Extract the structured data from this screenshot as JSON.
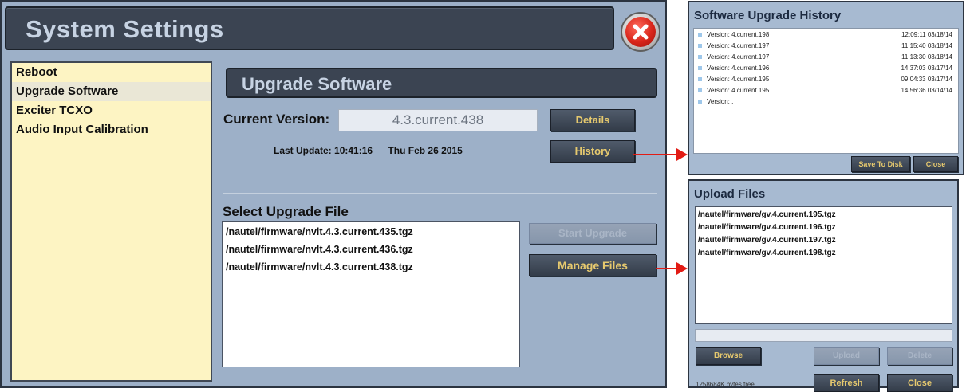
{
  "main": {
    "title": "System Settings",
    "sidebar": {
      "items": [
        {
          "label": "Reboot"
        },
        {
          "label": "Upgrade Software"
        },
        {
          "label": "Exciter TCXO"
        },
        {
          "label": "Audio Input Calibration"
        }
      ],
      "selected": "Upgrade Software"
    },
    "section_title": "Upgrade Software",
    "current_version_label": "Current Version:",
    "current_version_value": "4.3.current.438",
    "details_label": "Details",
    "history_label": "History",
    "last_update_label": "Last Update:",
    "last_update_time": "10:41:16",
    "last_update_date": "Thu Feb 26 2015",
    "select_file_label": "Select Upgrade File",
    "files": [
      "/nautel/firmware/nvlt.4.3.current.435.tgz",
      "/nautel/firmware/nvlt.4.3.current.436.tgz",
      "/nautel/firmware/nvlt.4.3.current.438.tgz"
    ],
    "start_upgrade_label": "Start Upgrade",
    "manage_files_label": "Manage Files"
  },
  "history_panel": {
    "title": "Software Upgrade History",
    "entries": [
      {
        "version": "Version: 4.current.198",
        "timestamp": "12:09:11 03/18/14"
      },
      {
        "version": "Version: 4.current.197",
        "timestamp": "11:15:40 03/18/14"
      },
      {
        "version": "Version: 4.current.197",
        "timestamp": "11:13:30 03/18/14"
      },
      {
        "version": "Version: 4.current.196",
        "timestamp": "14:37:03 03/17/14"
      },
      {
        "version": "Version: 4.current.195",
        "timestamp": "09:04:33 03/17/14"
      },
      {
        "version": "Version: 4.current.195",
        "timestamp": "14:56:36 03/14/14"
      },
      {
        "version": "Version: .",
        "timestamp": ""
      }
    ],
    "save_to_disk_label": "Save To Disk",
    "close_label": "Close"
  },
  "upload_panel": {
    "title": "Upload Files",
    "files": [
      "/nautel/firmware/gv.4.current.195.tgz",
      "/nautel/firmware/gv.4.current.196.tgz",
      "/nautel/firmware/gv.4.current.197.tgz",
      "/nautel/firmware/gv.4.current.198.tgz"
    ],
    "browse_label": "Browse",
    "upload_label": "Upload",
    "delete_label": "Delete",
    "refresh_label": "Refresh",
    "close_label": "Close",
    "free_space": "1258684K bytes free",
    "progress": 0
  },
  "icons": {
    "close": "close-circle-icon",
    "arrow": "arrow-right-icon",
    "list_bullet": "square-bullet-icon"
  },
  "colors": {
    "accent_button_text": "#e6c96e",
    "header_bg": "#3b4452",
    "sidebar_bg": "#fdf4c3",
    "arrow": "#e21b14"
  }
}
